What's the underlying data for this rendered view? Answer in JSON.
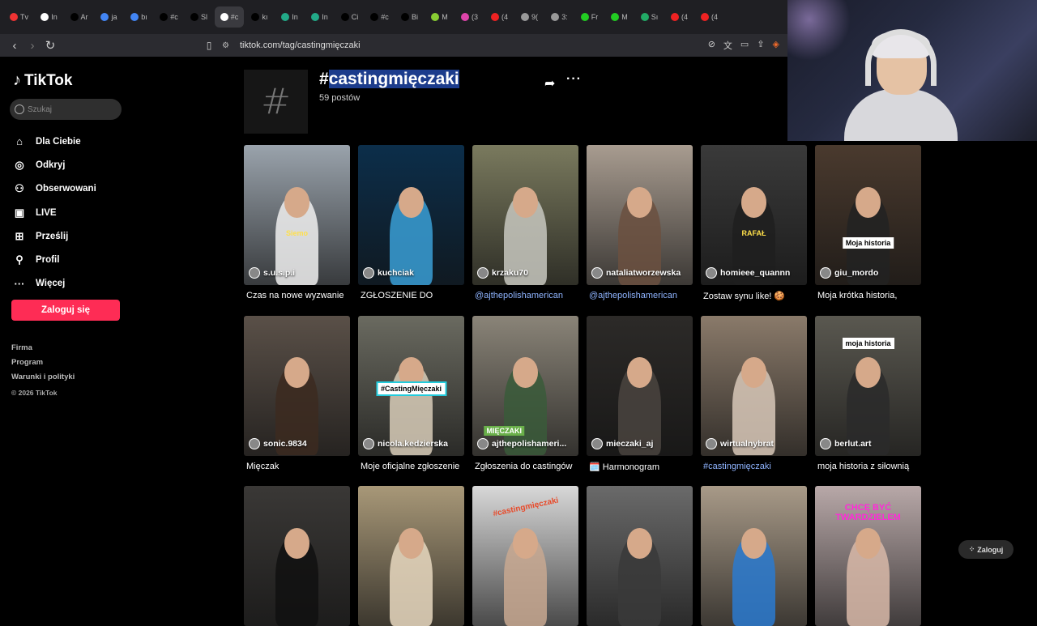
{
  "browser": {
    "tabs": [
      "Tv",
      "In",
      "Ar",
      "ja",
      "bı",
      "#c",
      "Sl",
      "#c",
      "kı",
      "In",
      "In",
      "Ci",
      "#c",
      "Bi",
      "M",
      "(3",
      "(4",
      "9(",
      "3:",
      "Fr",
      "M",
      "Sı",
      "(4",
      "(4"
    ],
    "url": "tiktok.com/tag/castingmięczaki"
  },
  "sidebar": {
    "logo": "TikTok",
    "search_placeholder": "Szukaj",
    "nav": [
      {
        "label": "Dla Ciebie",
        "icon": "home-icon"
      },
      {
        "label": "Odkryj",
        "icon": "compass-icon"
      },
      {
        "label": "Obserwowani",
        "icon": "following-icon"
      },
      {
        "label": "LIVE",
        "icon": "live-icon"
      },
      {
        "label": "Prześlij",
        "icon": "upload-icon"
      },
      {
        "label": "Profil",
        "icon": "profile-icon"
      },
      {
        "label": "Więcej",
        "icon": "more-icon"
      }
    ],
    "login": "Zaloguj się",
    "footer": [
      "Firma",
      "Program",
      "Warunki i polityki"
    ],
    "copyright": "© 2026 TikTok"
  },
  "header": {
    "hash_symbol": "#",
    "title_prefix": "#",
    "title_highlight": "castingmięczaki",
    "post_count": "59 postów"
  },
  "videos": [
    {
      "author": "s.u.s.p.i",
      "caption": "Czas na nowe wyzwanie",
      "link": false,
      "overlay": "Siemo",
      "bg": "#9aa3ac",
      "fig": "#f0f0f0"
    },
    {
      "author": "kuchciak",
      "caption": "ZGŁOSZENIE DO",
      "link": false,
      "overlay": "",
      "bg": "#0c2e4a",
      "fig": "#3a9fd6"
    },
    {
      "author": "krzaku70",
      "caption": "@ajthepolishamerican",
      "link": true,
      "overlay": "",
      "bg": "#7a7a5e",
      "fig": "#c8c8c0"
    },
    {
      "author": "nataliatworzewska",
      "caption": "@ajthepolishamerican",
      "link": true,
      "overlay": "",
      "bg": "#a89c90",
      "fig": "#6b5040"
    },
    {
      "author": "homieee_quannn",
      "caption": "Zostaw synu like! 🍪",
      "link": false,
      "overlay": "RAFAŁ",
      "bg": "#3a3a3a",
      "fig": "#1e1e1e"
    },
    {
      "author": "giu_mordo",
      "caption": "Moja krótka historia,",
      "link": false,
      "overlay": "Moja historia",
      "bg": "#4a3a2e",
      "fig": "#222"
    },
    {
      "author": "sonic.9834",
      "caption": "Mięczak",
      "link": false,
      "overlay": "",
      "bg": "#5a5048",
      "fig": "#3c2a20"
    },
    {
      "author": "nicola.kedzierska",
      "caption": "Moje oficjalne zgłoszenie",
      "link": false,
      "overlay": "#CastingMięczaki",
      "bg": "#6a6a60",
      "fig": "#d8cdb8"
    },
    {
      "author": "ajthepolishameri...",
      "caption": "Zgłoszenia do castingów",
      "link": false,
      "overlay": "MIĘCZAKI",
      "bg": "#8a8478",
      "fig": "#3a5a3a"
    },
    {
      "author": "mieczaki_aj",
      "caption": "🗓️ Harmonogram",
      "link": false,
      "overlay": "",
      "bg": "#2c2a28",
      "fig": "#4a4440"
    },
    {
      "author": "wirtualnybrat",
      "caption": "#castingmięczaki",
      "link": true,
      "overlay": "",
      "bg": "#8a7a6a",
      "fig": "#d8c8b8"
    },
    {
      "author": "berlut.art",
      "caption": "moja historia z siłownią",
      "link": false,
      "overlay": "moja historia",
      "bg": "#5a5850",
      "fig": "#2a2a2a"
    },
    {
      "author": "",
      "caption": "",
      "link": false,
      "overlay": "",
      "bg": "#3a3836",
      "fig": "#111"
    },
    {
      "author": "",
      "caption": "",
      "link": false,
      "overlay": "",
      "bg": "#a89878",
      "fig": "#e8d8c0"
    },
    {
      "author": "",
      "caption": "",
      "link": false,
      "overlay": "#castingmięczaki",
      "bg": "#d8d8d8",
      "fig": "#c8a890"
    },
    {
      "author": "",
      "caption": "",
      "link": false,
      "overlay": "",
      "bg": "#6a6a6a",
      "fig": "#3a3a3a"
    },
    {
      "author": "",
      "caption": "",
      "link": false,
      "overlay": "",
      "bg": "#a89a88",
      "fig": "#2a7ad0"
    },
    {
      "author": "",
      "caption": "",
      "link": false,
      "overlay": "CHCĘ BYĆ TWARDZIELEM",
      "bg": "#b8a8a8",
      "fig": "#d8b8a8"
    }
  ],
  "float_login": "Zaloguj"
}
